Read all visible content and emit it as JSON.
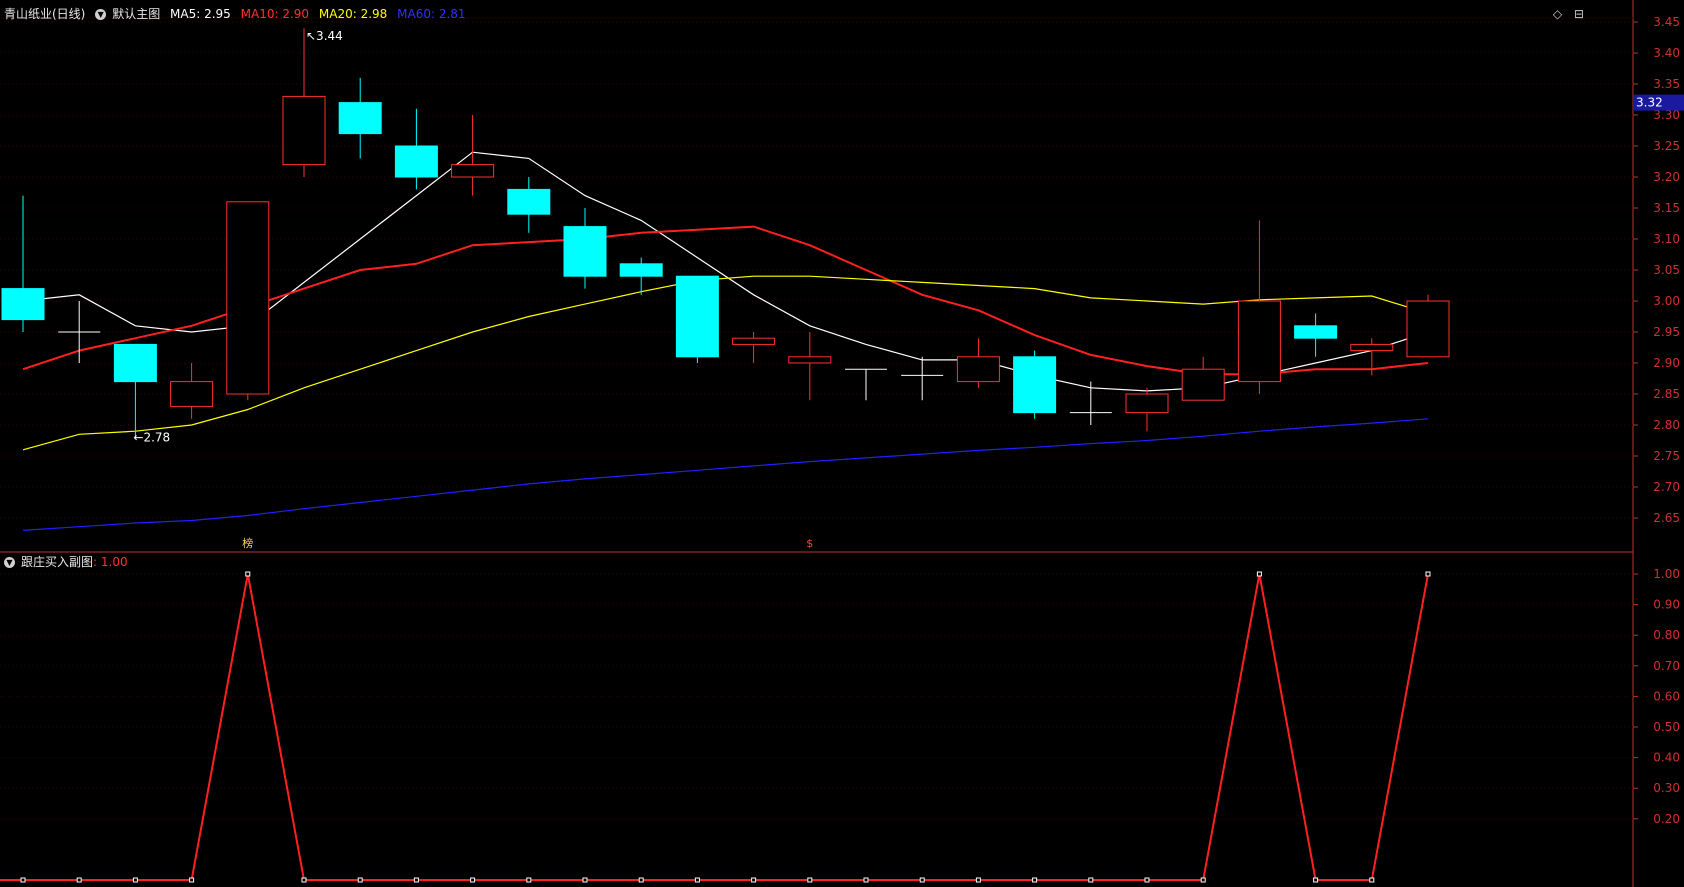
{
  "header": {
    "stock_name": "青山纸业(日线)",
    "template_label": "默认主图",
    "ma5_label": "MA5: 2.95",
    "ma10_label": "MA10: 2.90",
    "ma20_label": "MA20: 2.98",
    "ma60_label": "MA60: 2.81"
  },
  "sub_header": {
    "indicator_name": "跟庄买入副图",
    "indicator_value": ": 1.00"
  },
  "colors": {
    "background": "#000000",
    "up": "#ff3030",
    "down": "#00ffff",
    "ma5": "#ffffff",
    "ma10": "#ff2020",
    "ma20": "#ffff00",
    "ma60": "#2020ff",
    "axis": "#c03030",
    "grid": "#3a0000",
    "price_tag_bg": "#1a1aa0"
  },
  "icons": {
    "diamond": "◇",
    "panel": "⊟"
  },
  "chart_data": [
    {
      "type": "candlestick",
      "title": "青山纸业(日线)",
      "ylim": [
        2.62,
        3.46
      ],
      "yticks": [
        "3.45",
        "3.40",
        "3.35",
        "3.30",
        "3.25",
        "3.20",
        "3.15",
        "3.10",
        "3.05",
        "3.00",
        "2.95",
        "2.90",
        "2.85",
        "2.80",
        "2.75",
        "2.70",
        "2.65"
      ],
      "current_price_label": "3.32",
      "current_price": 3.32,
      "high_annotation": "3.44",
      "low_annotation": "2.78",
      "markers": [
        {
          "index": 4,
          "text": "榜"
        },
        {
          "index": 14,
          "text": "$"
        }
      ],
      "candles": [
        {
          "o": 3.02,
          "h": 3.17,
          "l": 2.95,
          "c": 2.97
        },
        {
          "o": 2.95,
          "h": 3.0,
          "l": 2.9,
          "c": 2.95
        },
        {
          "o": 2.93,
          "h": 2.93,
          "l": 2.78,
          "c": 2.87
        },
        {
          "o": 2.83,
          "h": 2.9,
          "l": 2.81,
          "c": 2.87
        },
        {
          "o": 2.85,
          "h": 3.16,
          "l": 2.84,
          "c": 3.16
        },
        {
          "o": 3.22,
          "h": 3.44,
          "l": 3.2,
          "c": 3.33
        },
        {
          "o": 3.32,
          "h": 3.36,
          "l": 3.23,
          "c": 3.27
        },
        {
          "o": 3.25,
          "h": 3.31,
          "l": 3.18,
          "c": 3.2
        },
        {
          "o": 3.2,
          "h": 3.3,
          "l": 3.17,
          "c": 3.22
        },
        {
          "o": 3.18,
          "h": 3.2,
          "l": 3.11,
          "c": 3.14
        },
        {
          "o": 3.12,
          "h": 3.15,
          "l": 3.02,
          "c": 3.04
        },
        {
          "o": 3.06,
          "h": 3.07,
          "l": 3.01,
          "c": 3.04
        },
        {
          "o": 3.04,
          "h": 3.04,
          "l": 2.9,
          "c": 2.91
        },
        {
          "o": 2.93,
          "h": 2.95,
          "l": 2.9,
          "c": 2.94
        },
        {
          "o": 2.9,
          "h": 2.95,
          "l": 2.84,
          "c": 2.91
        },
        {
          "o": 2.89,
          "h": 2.89,
          "l": 2.84,
          "c": 2.89
        },
        {
          "o": 2.88,
          "h": 2.91,
          "l": 2.84,
          "c": 2.88
        },
        {
          "o": 2.87,
          "h": 2.94,
          "l": 2.86,
          "c": 2.91
        },
        {
          "o": 2.91,
          "h": 2.92,
          "l": 2.81,
          "c": 2.82
        },
        {
          "o": 2.82,
          "h": 2.87,
          "l": 2.8,
          "c": 2.82
        },
        {
          "o": 2.82,
          "h": 2.86,
          "l": 2.79,
          "c": 2.85
        },
        {
          "o": 2.84,
          "h": 2.91,
          "l": 2.84,
          "c": 2.89
        },
        {
          "o": 2.87,
          "h": 3.13,
          "l": 2.85,
          "c": 3.0
        },
        {
          "o": 2.96,
          "h": 2.98,
          "l": 2.91,
          "c": 2.94
        },
        {
          "o": 2.92,
          "h": 2.94,
          "l": 2.88,
          "c": 2.93
        },
        {
          "o": 2.91,
          "h": 3.01,
          "l": 2.91,
          "c": 3.0
        }
      ],
      "series": [
        {
          "name": "MA5",
          "color": "#ffffff",
          "values": [
            3.0,
            3.01,
            2.96,
            2.95,
            2.96,
            3.03,
            3.1,
            3.17,
            3.24,
            3.23,
            3.17,
            3.13,
            3.07,
            3.01,
            2.96,
            2.93,
            2.905,
            2.905,
            2.88,
            2.86,
            2.855,
            2.86,
            2.88,
            2.9,
            2.92,
            2.95
          ]
        },
        {
          "name": "MA10",
          "color": "#ff2020",
          "values": [
            2.89,
            2.92,
            2.94,
            2.96,
            2.99,
            3.02,
            3.05,
            3.06,
            3.09,
            3.095,
            3.1,
            3.11,
            3.115,
            3.12,
            3.09,
            3.05,
            3.01,
            2.985,
            2.945,
            2.913,
            2.895,
            2.882,
            2.882,
            2.89,
            2.89,
            2.9
          ]
        },
        {
          "name": "MA20",
          "color": "#ffff00",
          "values": [
            2.76,
            2.785,
            2.79,
            2.8,
            2.825,
            2.86,
            2.89,
            2.92,
            2.95,
            2.975,
            2.995,
            3.015,
            3.033,
            3.04,
            3.04,
            3.035,
            3.03,
            3.025,
            3.02,
            3.005,
            3.0,
            2.995,
            3.002,
            3.005,
            3.008,
            2.98
          ]
        },
        {
          "name": "MA60",
          "color": "#2020ff",
          "values": [
            2.63,
            2.636,
            2.642,
            2.646,
            2.654,
            2.665,
            2.675,
            2.685,
            2.695,
            2.705,
            2.713,
            2.72,
            2.727,
            2.734,
            2.741,
            2.747,
            2.753,
            2.759,
            2.764,
            2.77,
            2.775,
            2.782,
            2.79,
            2.797,
            2.803,
            2.81
          ]
        }
      ]
    },
    {
      "type": "line",
      "title": "跟庄买入副图",
      "ylim": [
        0.0,
        1.0
      ],
      "yticks": [
        "1.00",
        "0.90",
        "0.80",
        "0.70",
        "0.60",
        "0.50",
        "0.40",
        "0.30",
        "0.20"
      ],
      "series": [
        {
          "name": "跟庄买入副图",
          "color": "#ff2020",
          "values": [
            0,
            0,
            0,
            0,
            1,
            0,
            0,
            0,
            0,
            0,
            0,
            0,
            0,
            0,
            0,
            0,
            0,
            0,
            0,
            0,
            0,
            0,
            1,
            0,
            0,
            1
          ]
        }
      ]
    }
  ]
}
